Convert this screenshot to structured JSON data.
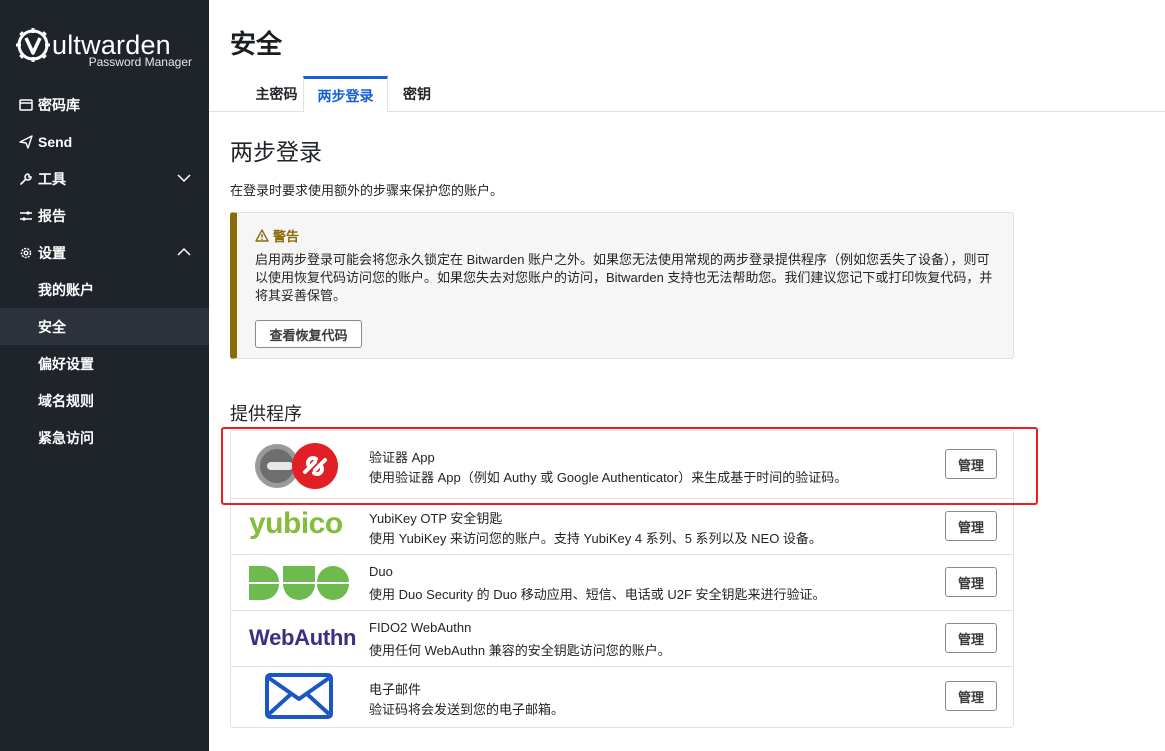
{
  "brand": {
    "name": "ultwarden",
    "subtitle": "Password Manager"
  },
  "sidebar": {
    "items": [
      {
        "label": "密码库",
        "icon": "vault-icon"
      },
      {
        "label": "Send",
        "icon": "send-icon"
      },
      {
        "label": "工具",
        "icon": "wrench-icon"
      },
      {
        "label": "报告",
        "icon": "sliders-icon"
      },
      {
        "label": "设置",
        "icon": "gear-icon"
      },
      {
        "label": "我的账户"
      },
      {
        "label": "安全"
      },
      {
        "label": "偏好设置"
      },
      {
        "label": "域名规则"
      },
      {
        "label": "紧急访问"
      }
    ]
  },
  "page": {
    "title": "安全",
    "tabs": [
      "主密码",
      "两步登录",
      "密钥"
    ]
  },
  "two_step": {
    "heading": "两步登录",
    "description": "在登录时要求使用额外的步骤来保护您的账户。",
    "warning_title": "警告",
    "warning_text": "启用两步登录可能会将您永久锁定在 Bitwarden 账户之外。如果您无法使用常规的两步登录提供程序（例如您丢失了设备），则可以使用恢复代码访问您的账户。如果您失去对您账户的访问，Bitwarden 支持也无法帮助您。我们建议您记下或打印恢复代码，并将其妥善保管。",
    "recovery_button": "查看恢复代码",
    "providers_heading": "提供程序",
    "manage_label": "管理",
    "providers": [
      {
        "name": "验证器 App",
        "desc": "使用验证器 App（例如 Authy 或 Google Authenticator）来生成基于时间的验证码。"
      },
      {
        "name": "YubiKey OTP 安全钥匙",
        "desc": "使用 YubiKey 来访问您的账户。支持 YubiKey 4 系列、5 系列以及 NEO 设备。",
        "logo_text": "yubico"
      },
      {
        "name": "Duo",
        "desc": "使用 Duo Security 的 Duo 移动应用、短信、电话或 U2F 安全钥匙来进行验证。"
      },
      {
        "name": "FIDO2 WebAuthn",
        "desc": "使用任何 WebAuthn 兼容的安全钥匙访问您的账户。",
        "logo_text": "WebAuthn"
      },
      {
        "name": "电子邮件",
        "desc": "验证码将会发送到您的电子邮箱。"
      }
    ]
  },
  "colors": {
    "sidebar_bg": "#1f242b",
    "accent": "#175ddc",
    "warning": "#8a6d0b",
    "highlight": "#e8221a"
  }
}
